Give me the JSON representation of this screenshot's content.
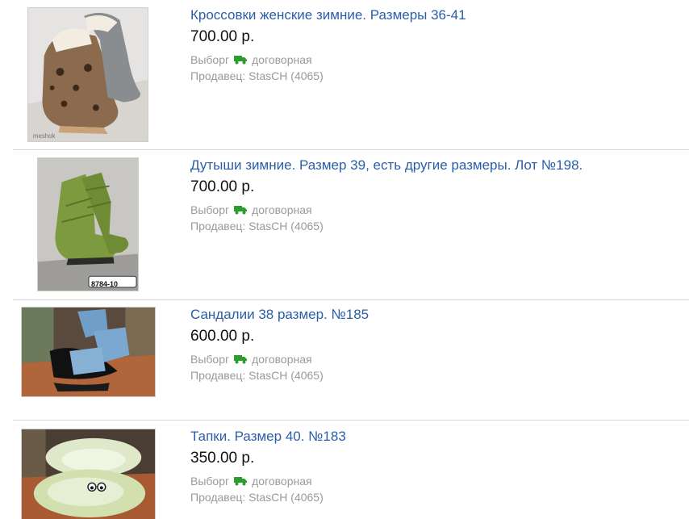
{
  "listings": [
    {
      "title": "Кроссовки женские зимние. Размеры 36-41",
      "price": "700.00 р.",
      "city": "Выборг",
      "delivery": "договорная",
      "seller_prefix": "Продавец:",
      "seller": "StasCH (4065)",
      "image_caption": ""
    },
    {
      "title": "Дутыши зимние. Размер 39, есть другие размеры. Лот №198.",
      "price": "700.00 р.",
      "city": "Выборг",
      "delivery": "договорная",
      "seller_prefix": "Продавец:",
      "seller": "StasCH (4065)",
      "image_caption": "8784-10"
    },
    {
      "title": "Сандалии 38 размер. №185",
      "price": "600.00 р.",
      "city": "Выборг",
      "delivery": "договорная",
      "seller_prefix": "Продавец:",
      "seller": "StasCH (4065)",
      "image_caption": ""
    },
    {
      "title": "Тапки. Размер 40. №183",
      "price": "350.00 р.",
      "city": "Выборг",
      "delivery": "договорная",
      "seller_prefix": "Продавец:",
      "seller": "StasCH (4065)",
      "image_caption": ""
    }
  ],
  "icons": {
    "delivery": "truck-icon"
  },
  "colors": {
    "title_link": "#2a5ea8",
    "price": "#111111",
    "meta": "#9a9a9a",
    "truck": "#2e9b2e",
    "divider": "#d9d9d9"
  }
}
